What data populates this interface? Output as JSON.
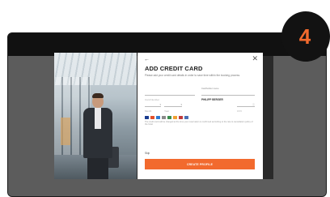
{
  "step_badge": {
    "number": "4",
    "color": "#f26a2e"
  },
  "modal": {
    "back_icon": "arrow-left-icon",
    "close_icon": "close-icon",
    "title": "ADD CREDIT CARD",
    "subtitle": "Please add your credit card details in order to save time within the booking process.",
    "card_number": {
      "placeholder": "Card Number"
    },
    "cardholder": {
      "label": "Cardholder name",
      "value": "PHILIPP BERGER"
    },
    "expiry_month": {
      "value": "Month"
    },
    "expiry_year": {
      "value": "Year"
    },
    "cvv": {
      "placeholder": "CVV"
    },
    "accepted_brands": [
      "visa",
      "mastercard",
      "amex",
      "diners",
      "jcb",
      "discover",
      "unionpay",
      "maestro"
    ],
    "note": "The credit card will be charged at the time your reservation is confirmed according to the rate & cancellation policy of the hotel",
    "skip_label": "Skip",
    "cta_label": "CREATE PROFILE",
    "accent_color": "#f26a2e"
  }
}
